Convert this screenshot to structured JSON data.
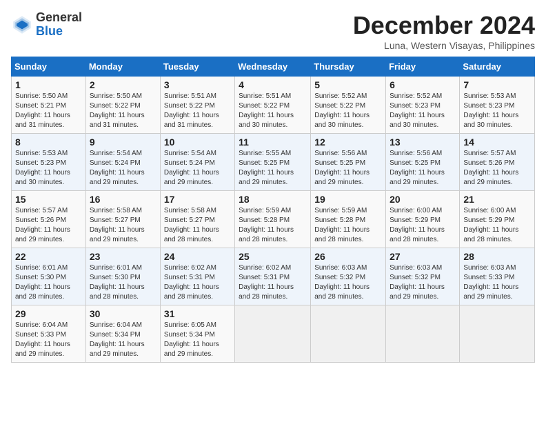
{
  "header": {
    "logo_general": "General",
    "logo_blue": "Blue",
    "month_title": "December 2024",
    "location": "Luna, Western Visayas, Philippines"
  },
  "days_of_week": [
    "Sunday",
    "Monday",
    "Tuesday",
    "Wednesday",
    "Thursday",
    "Friday",
    "Saturday"
  ],
  "weeks": [
    [
      {
        "day": "1",
        "sunrise": "Sunrise: 5:50 AM",
        "sunset": "Sunset: 5:21 PM",
        "daylight": "Daylight: 11 hours and 31 minutes."
      },
      {
        "day": "2",
        "sunrise": "Sunrise: 5:50 AM",
        "sunset": "Sunset: 5:22 PM",
        "daylight": "Daylight: 11 hours and 31 minutes."
      },
      {
        "day": "3",
        "sunrise": "Sunrise: 5:51 AM",
        "sunset": "Sunset: 5:22 PM",
        "daylight": "Daylight: 11 hours and 31 minutes."
      },
      {
        "day": "4",
        "sunrise": "Sunrise: 5:51 AM",
        "sunset": "Sunset: 5:22 PM",
        "daylight": "Daylight: 11 hours and 30 minutes."
      },
      {
        "day": "5",
        "sunrise": "Sunrise: 5:52 AM",
        "sunset": "Sunset: 5:22 PM",
        "daylight": "Daylight: 11 hours and 30 minutes."
      },
      {
        "day": "6",
        "sunrise": "Sunrise: 5:52 AM",
        "sunset": "Sunset: 5:23 PM",
        "daylight": "Daylight: 11 hours and 30 minutes."
      },
      {
        "day": "7",
        "sunrise": "Sunrise: 5:53 AM",
        "sunset": "Sunset: 5:23 PM",
        "daylight": "Daylight: 11 hours and 30 minutes."
      }
    ],
    [
      {
        "day": "8",
        "sunrise": "Sunrise: 5:53 AM",
        "sunset": "Sunset: 5:23 PM",
        "daylight": "Daylight: 11 hours and 30 minutes."
      },
      {
        "day": "9",
        "sunrise": "Sunrise: 5:54 AM",
        "sunset": "Sunset: 5:24 PM",
        "daylight": "Daylight: 11 hours and 29 minutes."
      },
      {
        "day": "10",
        "sunrise": "Sunrise: 5:54 AM",
        "sunset": "Sunset: 5:24 PM",
        "daylight": "Daylight: 11 hours and 29 minutes."
      },
      {
        "day": "11",
        "sunrise": "Sunrise: 5:55 AM",
        "sunset": "Sunset: 5:25 PM",
        "daylight": "Daylight: 11 hours and 29 minutes."
      },
      {
        "day": "12",
        "sunrise": "Sunrise: 5:56 AM",
        "sunset": "Sunset: 5:25 PM",
        "daylight": "Daylight: 11 hours and 29 minutes."
      },
      {
        "day": "13",
        "sunrise": "Sunrise: 5:56 AM",
        "sunset": "Sunset: 5:25 PM",
        "daylight": "Daylight: 11 hours and 29 minutes."
      },
      {
        "day": "14",
        "sunrise": "Sunrise: 5:57 AM",
        "sunset": "Sunset: 5:26 PM",
        "daylight": "Daylight: 11 hours and 29 minutes."
      }
    ],
    [
      {
        "day": "15",
        "sunrise": "Sunrise: 5:57 AM",
        "sunset": "Sunset: 5:26 PM",
        "daylight": "Daylight: 11 hours and 29 minutes."
      },
      {
        "day": "16",
        "sunrise": "Sunrise: 5:58 AM",
        "sunset": "Sunset: 5:27 PM",
        "daylight": "Daylight: 11 hours and 29 minutes."
      },
      {
        "day": "17",
        "sunrise": "Sunrise: 5:58 AM",
        "sunset": "Sunset: 5:27 PM",
        "daylight": "Daylight: 11 hours and 28 minutes."
      },
      {
        "day": "18",
        "sunrise": "Sunrise: 5:59 AM",
        "sunset": "Sunset: 5:28 PM",
        "daylight": "Daylight: 11 hours and 28 minutes."
      },
      {
        "day": "19",
        "sunrise": "Sunrise: 5:59 AM",
        "sunset": "Sunset: 5:28 PM",
        "daylight": "Daylight: 11 hours and 28 minutes."
      },
      {
        "day": "20",
        "sunrise": "Sunrise: 6:00 AM",
        "sunset": "Sunset: 5:29 PM",
        "daylight": "Daylight: 11 hours and 28 minutes."
      },
      {
        "day": "21",
        "sunrise": "Sunrise: 6:00 AM",
        "sunset": "Sunset: 5:29 PM",
        "daylight": "Daylight: 11 hours and 28 minutes."
      }
    ],
    [
      {
        "day": "22",
        "sunrise": "Sunrise: 6:01 AM",
        "sunset": "Sunset: 5:30 PM",
        "daylight": "Daylight: 11 hours and 28 minutes."
      },
      {
        "day": "23",
        "sunrise": "Sunrise: 6:01 AM",
        "sunset": "Sunset: 5:30 PM",
        "daylight": "Daylight: 11 hours and 28 minutes."
      },
      {
        "day": "24",
        "sunrise": "Sunrise: 6:02 AM",
        "sunset": "Sunset: 5:31 PM",
        "daylight": "Daylight: 11 hours and 28 minutes."
      },
      {
        "day": "25",
        "sunrise": "Sunrise: 6:02 AM",
        "sunset": "Sunset: 5:31 PM",
        "daylight": "Daylight: 11 hours and 28 minutes."
      },
      {
        "day": "26",
        "sunrise": "Sunrise: 6:03 AM",
        "sunset": "Sunset: 5:32 PM",
        "daylight": "Daylight: 11 hours and 28 minutes."
      },
      {
        "day": "27",
        "sunrise": "Sunrise: 6:03 AM",
        "sunset": "Sunset: 5:32 PM",
        "daylight": "Daylight: 11 hours and 29 minutes."
      },
      {
        "day": "28",
        "sunrise": "Sunrise: 6:03 AM",
        "sunset": "Sunset: 5:33 PM",
        "daylight": "Daylight: 11 hours and 29 minutes."
      }
    ],
    [
      {
        "day": "29",
        "sunrise": "Sunrise: 6:04 AM",
        "sunset": "Sunset: 5:33 PM",
        "daylight": "Daylight: 11 hours and 29 minutes."
      },
      {
        "day": "30",
        "sunrise": "Sunrise: 6:04 AM",
        "sunset": "Sunset: 5:34 PM",
        "daylight": "Daylight: 11 hours and 29 minutes."
      },
      {
        "day": "31",
        "sunrise": "Sunrise: 6:05 AM",
        "sunset": "Sunset: 5:34 PM",
        "daylight": "Daylight: 11 hours and 29 minutes."
      },
      null,
      null,
      null,
      null
    ]
  ]
}
